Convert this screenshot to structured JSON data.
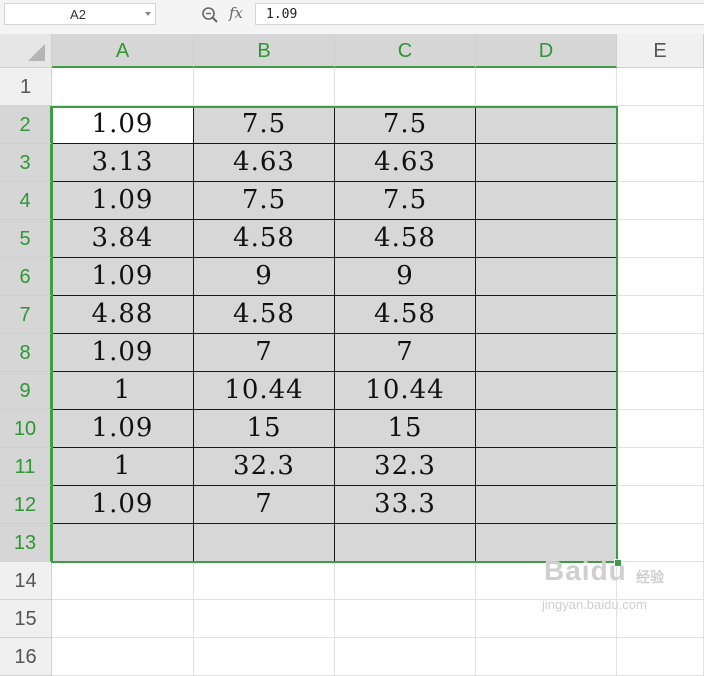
{
  "formula_bar": {
    "name_box": "A2",
    "fx_label": "fx",
    "formula_value": "1.09"
  },
  "columns": [
    "A",
    "B",
    "C",
    "D",
    "E"
  ],
  "rows": [
    "1",
    "2",
    "3",
    "4",
    "5",
    "6",
    "7",
    "8",
    "9",
    "10",
    "11",
    "12",
    "13",
    "14",
    "15",
    "16"
  ],
  "table": [
    [
      "1.09",
      "7.5",
      "7.5",
      ""
    ],
    [
      "3.13",
      "4.63",
      "4.63",
      ""
    ],
    [
      "1.09",
      "7.5",
      "7.5",
      ""
    ],
    [
      "3.84",
      "4.58",
      "4.58",
      ""
    ],
    [
      "1.09",
      "9",
      "9",
      ""
    ],
    [
      "4.88",
      "4.58",
      "4.58",
      ""
    ],
    [
      "1.09",
      "7",
      "7",
      ""
    ],
    [
      "1",
      "10.44",
      "10.44",
      ""
    ],
    [
      "1.09",
      "15",
      "15",
      ""
    ],
    [
      "1",
      "32.3",
      "32.3",
      ""
    ],
    [
      "1.09",
      "7",
      "33.3",
      ""
    ],
    [
      "",
      "",
      "",
      ""
    ]
  ],
  "colors": {
    "selection_accent": "#3e9b46",
    "selected_fill": "#d7d7d7",
    "header_text_selected": "#2e9632"
  },
  "watermark": {
    "main": "Baidu",
    "sub": "经验",
    "url": "jingyan.baidu.com"
  }
}
